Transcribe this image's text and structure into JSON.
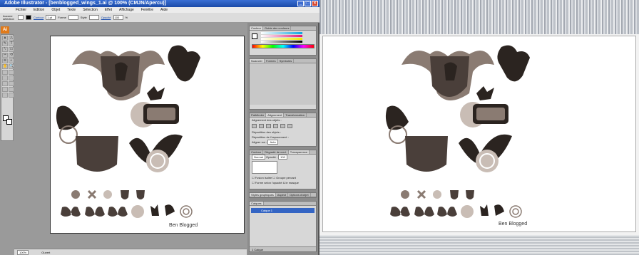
{
  "window": {
    "title": "Adobe Illustrator - [benblogged_wings_1.ai @ 100% (CMJN/Apercu)]",
    "controls": [
      "_",
      "□",
      "×"
    ]
  },
  "menu": [
    "Fichier",
    "Edition",
    "Objet",
    "Texte",
    "Sélection",
    "Effet",
    "Affichage",
    "Fenêtre",
    "Aide"
  ],
  "control_bar": {
    "selection_label": "Aucune sélection",
    "stroke_label": "Contour",
    "stroke_value": "1 pt",
    "shape_label": "Forme",
    "style_label": "Style",
    "opacity_label": "Opacité",
    "opacity_value": "100",
    "opacity_unit": "%"
  },
  "app_logo": "Ai",
  "tools": [
    "▲",
    "△",
    "✎",
    "T",
    "\\",
    "▭",
    "✂",
    "⟲",
    "≋",
    "◐",
    "✋",
    "🔍"
  ],
  "panels": {
    "color": {
      "tabs": [
        "Couleur",
        "Guide des couleurs"
      ],
      "channels": [
        "C",
        "M",
        "J",
        "N"
      ],
      "unit": "%"
    },
    "swatches": {
      "tabs": [
        "Nuancier",
        "Formes",
        "Symboles"
      ]
    },
    "align": {
      "tabs": [
        "Pathfinder",
        "Alignement",
        "Transformation"
      ],
      "align_objects": "Alignement des objets :",
      "distribute_objects": "Répartition des objets :",
      "distribute_spacing": "Répartition de l'espacement :",
      "align_to": "Aligner sur :",
      "auto": "Auto"
    },
    "transparency": {
      "tabs": [
        "Contour",
        "Dégradé de coul.",
        "Transparence"
      ],
      "mode": "Normal",
      "opacity_label": "Opacité :",
      "opacity_value": "100",
      "isolate": "Fusion isolée",
      "knockout": "Groupe percant",
      "mask_opacity": "Forme selon l'opacité & le masque"
    },
    "graphic_styles": {
      "tabs": [
        "Styles graphiques",
        "Aspect",
        "Options d'objet"
      ]
    },
    "layers": {
      "tabs": [
        "Calques"
      ],
      "layer_name": "Calque 1",
      "footer": "1 Calque"
    }
  },
  "status": {
    "zoom": "100%",
    "state": "Ouvert"
  },
  "artwork": {
    "signature": "Ben Blogged",
    "palette": {
      "dark": "#4a3f3a",
      "mid": "#8a7b72",
      "light": "#c9bdb5"
    }
  }
}
